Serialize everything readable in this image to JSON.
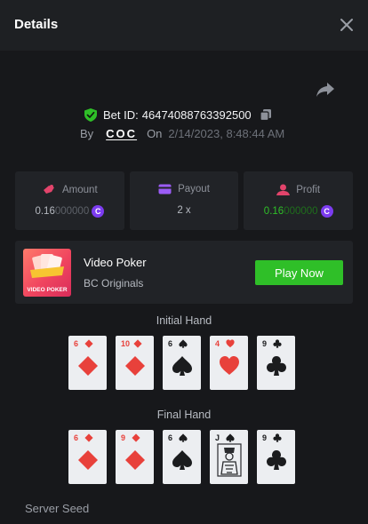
{
  "header": {
    "title": "Details"
  },
  "bet": {
    "label": "Bet ID:",
    "id": "46474088763392500",
    "by_label": "By",
    "user": "COC",
    "on_label": "On",
    "datetime": "2/14/2023, 8:48:44 AM"
  },
  "stats": {
    "amount": {
      "label": "Amount",
      "bright": "0.16",
      "dim": "000000"
    },
    "payout": {
      "label": "Payout",
      "value": "2 x"
    },
    "profit": {
      "label": "Profit",
      "bright": "0.16",
      "dim": "000000"
    },
    "coin_symbol": "C"
  },
  "game": {
    "name": "Video Poker",
    "provider": "BC Originals",
    "play_label": "Play Now",
    "thumb_label": "VIDEO POKER"
  },
  "initial_hand": {
    "title": "Initial Hand",
    "cards": [
      {
        "rank": "6",
        "suit": "diamond"
      },
      {
        "rank": "10",
        "suit": "diamond"
      },
      {
        "rank": "6",
        "suit": "spade"
      },
      {
        "rank": "4",
        "suit": "heart"
      },
      {
        "rank": "9",
        "suit": "club"
      }
    ]
  },
  "final_hand": {
    "title": "Final Hand",
    "cards": [
      {
        "rank": "6",
        "suit": "diamond"
      },
      {
        "rank": "9",
        "suit": "diamond"
      },
      {
        "rank": "6",
        "suit": "spade"
      },
      {
        "rank": "J",
        "suit": "spade"
      },
      {
        "rank": "9",
        "suit": "club"
      }
    ]
  },
  "server_seed": {
    "label": "Server Seed"
  },
  "colors": {
    "background": "#17181b",
    "panel": "#212327",
    "accent_green": "#2fbf28",
    "coin_purple": "#7c3cf0",
    "red_suit": "#e8413b",
    "black_suit": "#1b1c1e"
  }
}
